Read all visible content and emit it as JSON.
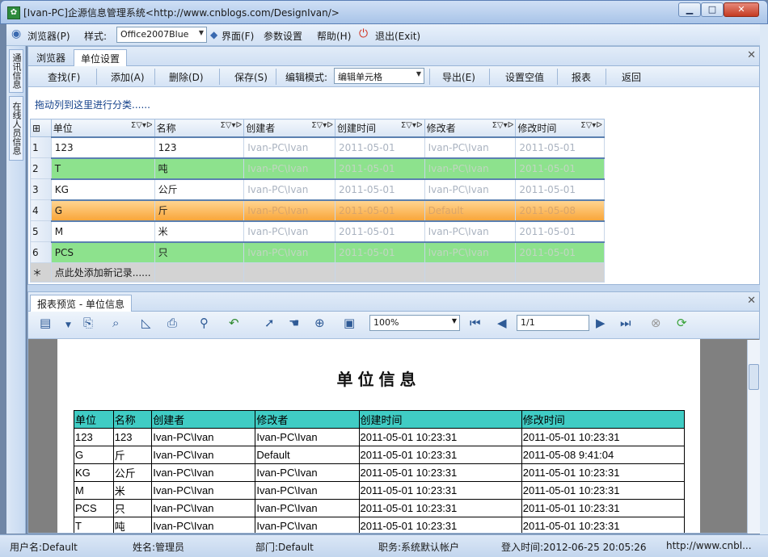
{
  "window": {
    "title": "[Ivan-PC]企源信息管理系统<http://www.cnblogs.com/DesignIvan/>"
  },
  "menu": {
    "browser": "浏览器(P)",
    "style_label": "样式:",
    "style_value": "Office2007Blue",
    "ui": "界面(F)",
    "params": "参数设置",
    "help": "帮助(H)",
    "exit": "退出(Exit)"
  },
  "dock": {
    "tab1": "通讯信息",
    "tab2": "在线人员信息"
  },
  "tabs": {
    "t1": "浏览器",
    "t2": "单位设置"
  },
  "toolbar": {
    "query": "查找(F)",
    "add": "添加(A)",
    "delete": "删除(D)",
    "save": "保存(S)",
    "edit_mode_label": "编辑模式:",
    "edit_mode_value": "编辑单元格",
    "export": "导出(E)",
    "null_value": "设置空值",
    "report": "报表",
    "back": "返回"
  },
  "group_hint": "拖动列到这里进行分类......",
  "grid": {
    "headers": [
      "单位",
      "名称",
      "创建者",
      "创建时间",
      "修改者",
      "修改时间"
    ],
    "rows": [
      [
        "1",
        "123",
        "123",
        "Ivan-PC\\Ivan",
        "2011-05-01",
        "Ivan-PC\\Ivan",
        "2011-05-01"
      ],
      [
        "2",
        "T",
        "吨",
        "Ivan-PC\\Ivan",
        "2011-05-01",
        "Ivan-PC\\Ivan",
        "2011-05-01"
      ],
      [
        "3",
        "KG",
        "公斤",
        "Ivan-PC\\Ivan",
        "2011-05-01",
        "Ivan-PC\\Ivan",
        "2011-05-01"
      ],
      [
        "4",
        "G",
        "斤",
        "Ivan-PC\\Ivan",
        "2011-05-01",
        "Default",
        "2011-05-08"
      ],
      [
        "5",
        "M",
        "米",
        "Ivan-PC\\Ivan",
        "2011-05-01",
        "Ivan-PC\\Ivan",
        "2011-05-01"
      ],
      [
        "6",
        "PCS",
        "只",
        "Ivan-PC\\Ivan",
        "2011-05-01",
        "Ivan-PC\\Ivan",
        "2011-05-01"
      ]
    ],
    "new_row_marker": "＊",
    "new_row_text": "点此处添加新记录......"
  },
  "preview": {
    "tab": "报表预览 - 单位信息",
    "zoom": "100%",
    "page": "1/1",
    "report_title": "单位信息",
    "headers": [
      "单位",
      "名称",
      "创建者",
      "修改者",
      "创建时间",
      "修改时间"
    ],
    "rows": [
      [
        "123",
        "123",
        "Ivan-PC\\Ivan",
        "Ivan-PC\\Ivan",
        "2011-05-01 10:23:31",
        "2011-05-01 10:23:31"
      ],
      [
        "G",
        "斤",
        "Ivan-PC\\Ivan",
        "Default",
        "2011-05-01 10:23:31",
        "2011-05-08 9:41:04"
      ],
      [
        "KG",
        "公斤",
        "Ivan-PC\\Ivan",
        "Ivan-PC\\Ivan",
        "2011-05-01 10:23:31",
        "2011-05-01 10:23:31"
      ],
      [
        "M",
        "米",
        "Ivan-PC\\Ivan",
        "Ivan-PC\\Ivan",
        "2011-05-01 10:23:31",
        "2011-05-01 10:23:31"
      ],
      [
        "PCS",
        "只",
        "Ivan-PC\\Ivan",
        "Ivan-PC\\Ivan",
        "2011-05-01 10:23:31",
        "2011-05-01 10:23:31"
      ],
      [
        "T",
        "吨",
        "Ivan-PC\\Ivan",
        "Ivan-PC\\Ivan",
        "2011-05-01 10:23:31",
        "2011-05-01 10:23:31"
      ]
    ]
  },
  "status": {
    "user": "用户名:Default",
    "name": "姓名:管理员",
    "dept": "部门:Default",
    "role": "职务:系统默认帐户",
    "login": "登入时间:2012-06-25 20:05:26",
    "url": "http://www.cnbl..."
  }
}
